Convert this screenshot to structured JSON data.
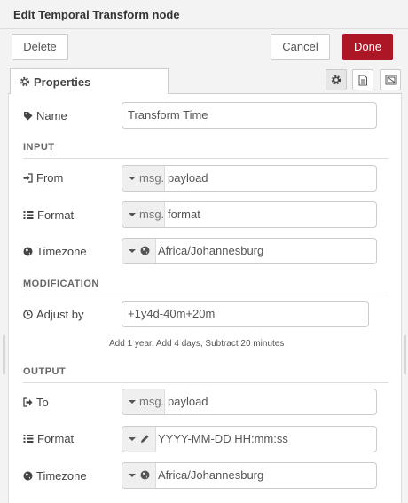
{
  "header": {
    "title": "Edit Temporal Transform node"
  },
  "toolbar": {
    "delete_label": "Delete",
    "cancel_label": "Cancel",
    "done_label": "Done"
  },
  "tabs": {
    "properties_label": "Properties"
  },
  "icons": {
    "properties_tab": "gear-icon",
    "settings": "gear-icon",
    "description": "document-icon",
    "appearance": "frame-icon",
    "name": "tag-icon",
    "from": "sign-in-icon",
    "format": "list-icon",
    "timezone": "globe-icon",
    "adjust": "clock-icon",
    "to": "sign-out-icon",
    "format_edit": "pencil-icon"
  },
  "colors": {
    "done_button": "#ad1625",
    "panel_bg": "#ffffff",
    "tray_bg": "#f3f3f3"
  },
  "form": {
    "name": {
      "label": "Name",
      "value": "Transform Time"
    },
    "input_section": "INPUT",
    "from": {
      "label": "From",
      "prefix": "msg.",
      "value": "payload"
    },
    "format": {
      "label": "Format",
      "prefix": "msg.",
      "value": "format"
    },
    "timezone": {
      "label": "Timezone",
      "value": "Africa/Johannesburg"
    },
    "modification_section": "MODIFICATION",
    "adjust": {
      "label": "Adjust by",
      "value": "+1y4d-40m+20m",
      "hint": "Add 1 year, Add 4 days, Subtract 20 minutes"
    },
    "output_section": "OUTPUT",
    "to": {
      "label": "To",
      "prefix": "msg.",
      "value": "payload"
    },
    "out_format": {
      "label": "Format",
      "value": "YYYY-MM-DD HH:mm:ss"
    },
    "out_timezone": {
      "label": "Timezone",
      "value": "Africa/Johannesburg"
    }
  }
}
